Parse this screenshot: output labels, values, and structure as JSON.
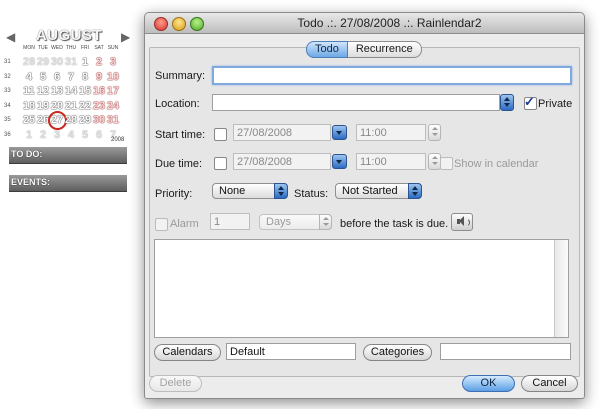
{
  "calendar": {
    "month": "AUGUST",
    "prev_glyph": "◀",
    "next_glyph": "▶",
    "weekdays": [
      "MON",
      "TUE",
      "WED",
      "THU",
      "FRI",
      "SAT",
      "SUN"
    ],
    "weeks": [
      {
        "wk": "31",
        "days": [
          "28",
          "29",
          "30",
          "31",
          "1",
          "2",
          "3"
        ]
      },
      {
        "wk": "32",
        "days": [
          "4",
          "5",
          "6",
          "7",
          "8",
          "9",
          "10"
        ]
      },
      {
        "wk": "33",
        "days": [
          "11",
          "12",
          "13",
          "14",
          "15",
          "16",
          "17"
        ]
      },
      {
        "wk": "34",
        "days": [
          "18",
          "19",
          "20",
          "21",
          "22",
          "23",
          "24"
        ]
      },
      {
        "wk": "35",
        "days": [
          "25",
          "26",
          "27",
          "28",
          "29",
          "30",
          "31"
        ]
      },
      {
        "wk": "36",
        "days": [
          "1",
          "2",
          "3",
          "4",
          "5",
          "6",
          "7"
        ]
      }
    ],
    "year": "2008",
    "todo_label": "TO DO:",
    "events_label": "EVENTS:"
  },
  "window": {
    "title": "Todo .:. 27/08/2008 .:. Rainlendar2"
  },
  "tabs": {
    "todo": "Todo",
    "recurrence": "Recurrence"
  },
  "form": {
    "summary_label": "Summary:",
    "summary_value": "",
    "location_label": "Location:",
    "location_value": "",
    "private_label": "Private",
    "start_time_label": "Start time:",
    "start_date": "27/08/2008",
    "start_clock": "11:00",
    "due_time_label": "Due time:",
    "due_date": "27/08/2008",
    "due_clock": "11:00",
    "show_in_calendar_label": "Show in calendar",
    "priority_label": "Priority:",
    "priority_value": "None",
    "status_label": "Status:",
    "status_value": "Not Started",
    "alarm_label": "Alarm",
    "alarm_amount": "1",
    "alarm_unit": "Days",
    "alarm_suffix": "before the task is due.",
    "notes_value": ""
  },
  "bottom": {
    "calendars_button": "Calendars",
    "calendars_value": "Default",
    "categories_button": "Categories",
    "categories_value": "",
    "delete_button": "Delete",
    "ok_button": "OK",
    "cancel_button": "Cancel"
  }
}
